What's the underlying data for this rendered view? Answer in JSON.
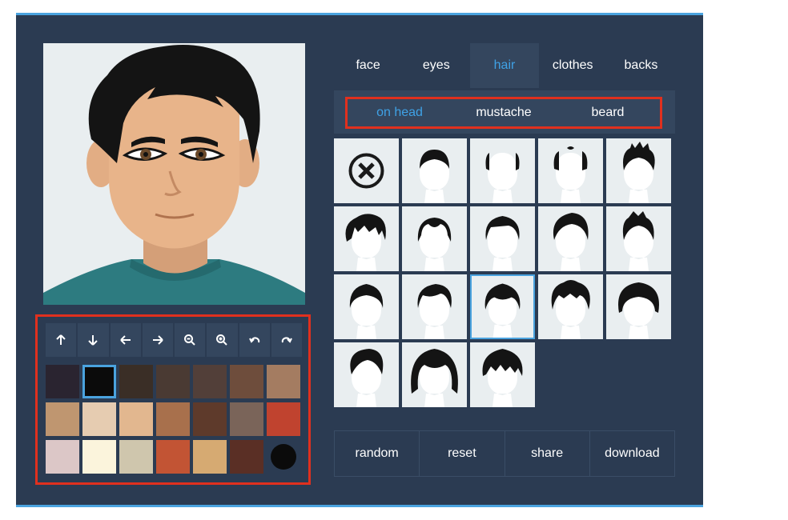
{
  "tabs": [
    {
      "label": "face",
      "active": false
    },
    {
      "label": "eyes",
      "active": false
    },
    {
      "label": "hair",
      "active": true
    },
    {
      "label": "clothes",
      "active": false
    },
    {
      "label": "backs",
      "active": false
    }
  ],
  "subtabs": [
    {
      "label": "on head",
      "active": true
    },
    {
      "label": "mustache",
      "active": false
    },
    {
      "label": "beard",
      "active": false
    }
  ],
  "tools": [
    {
      "name": "move-up",
      "icon": "arrow-up-icon"
    },
    {
      "name": "move-down",
      "icon": "arrow-down-icon"
    },
    {
      "name": "move-left",
      "icon": "arrow-left-icon"
    },
    {
      "name": "move-right",
      "icon": "arrow-right-icon"
    },
    {
      "name": "zoom-out",
      "icon": "zoom-out-icon"
    },
    {
      "name": "zoom-in",
      "icon": "zoom-in-icon"
    },
    {
      "name": "undo",
      "icon": "undo-icon"
    },
    {
      "name": "redo",
      "icon": "redo-icon"
    }
  ],
  "swatches": [
    "#2a2430",
    "#0b0b0b",
    "#3a2e26",
    "#4a3a33",
    "#523f39",
    "#6e4d3c",
    "#a47c61",
    "#bf9670",
    "#e6ccb1",
    "#e2b78f",
    "#a8704c",
    "#5e3a2b",
    "#7a6459",
    "#c0432f",
    "#dcc7c7",
    "#fbf4dc",
    "#cfc6ad",
    "#c25434",
    "#d6aa72",
    "#5a2f25",
    "#0b0b0b"
  ],
  "selected_swatch": 1,
  "hair_styles": [
    "none",
    "short-round",
    "bald-sides",
    "balding-top",
    "spiky",
    "messy",
    "receding",
    "side-part",
    "quiff",
    "spiky-top",
    "classic",
    "side-swept",
    "wavy",
    "curly-top",
    "bowl",
    "undercut",
    "long-shaggy",
    "fringe"
  ],
  "selected_hair": 12,
  "actions": [
    {
      "label": "random"
    },
    {
      "label": "reset"
    },
    {
      "label": "share"
    },
    {
      "label": "download"
    }
  ],
  "colors": {
    "panel": "#2b3b52",
    "accent": "#4aa3df",
    "highlight": "#e0301e",
    "skin": "#e8b48a",
    "hair": "#141414",
    "shirt": "#2d7b80"
  }
}
